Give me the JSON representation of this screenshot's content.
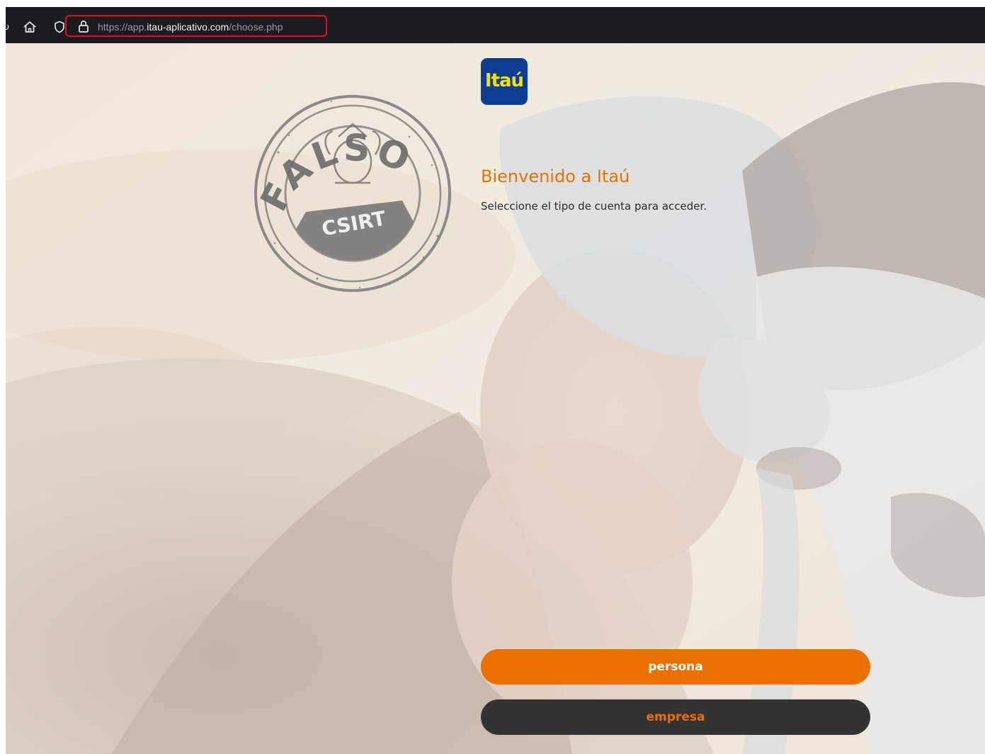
{
  "browser": {
    "url_prefix": "https://app.",
    "url_host": "itau-aplicativo.com",
    "url_path": "/choose.php",
    "toolbar_color": "#1c1b22",
    "highlight_color": "#e0101a",
    "icons": [
      "refresh-icon",
      "home-icon",
      "shield-icon",
      "lock-icon"
    ]
  },
  "page": {
    "logo_text": "Itaú",
    "title": "Bienvenido a Itaú",
    "subtitle": "Seleccione el tipo de cuenta para acceder.",
    "colors": {
      "brand_orange": "#ec7000",
      "logo_blue": "#0b3d91",
      "logo_yellow": "#f6e200",
      "dark_button": "#333333"
    }
  },
  "stamp": {
    "word": "FALSO",
    "org": "CSIRT"
  },
  "actions": {
    "persona_label": "persona",
    "empresa_label": "empresa"
  }
}
